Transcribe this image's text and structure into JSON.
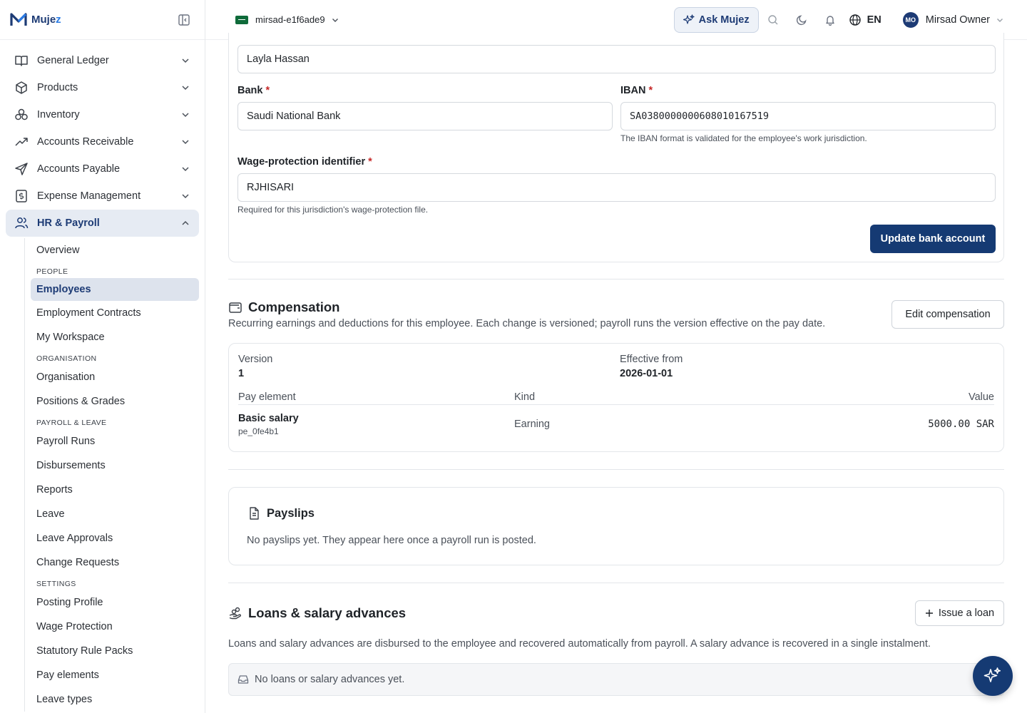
{
  "brand": {
    "name_a": "Muje",
    "name_b": "z"
  },
  "sidebar": {
    "items": [
      {
        "label": "General Ledger",
        "icon": "book-icon"
      },
      {
        "label": "Products",
        "icon": "box-icon"
      },
      {
        "label": "Inventory",
        "icon": "boxes-icon"
      },
      {
        "label": "Accounts Receivable",
        "icon": "trend-up-icon"
      },
      {
        "label": "Accounts Payable",
        "icon": "send-icon"
      },
      {
        "label": "Expense Management",
        "icon": "receipt-icon"
      },
      {
        "label": "HR & Payroll",
        "icon": "users-icon"
      }
    ],
    "hr": {
      "overview": "Overview",
      "section_people": "PEOPLE",
      "employees": "Employees",
      "employment_contracts": "Employment Contracts",
      "my_workspace": "My Workspace",
      "section_organisation": "ORGANISATION",
      "organisation": "Organisation",
      "positions_grades": "Positions & Grades",
      "section_payroll_leave": "PAYROLL & LEAVE",
      "payroll_runs": "Payroll Runs",
      "disbursements": "Disbursements",
      "reports": "Reports",
      "leave": "Leave",
      "leave_approvals": "Leave Approvals",
      "change_requests": "Change Requests",
      "section_settings": "SETTINGS",
      "posting_profile": "Posting Profile",
      "wage_protection": "Wage Protection",
      "statutory_rule_packs": "Statutory Rule Packs",
      "pay_elements": "Pay elements",
      "leave_types": "Leave types"
    }
  },
  "topbar": {
    "org": "mirsad-e1f6ade9",
    "ask": "Ask Mujez",
    "lang": "EN",
    "user_initials": "MO",
    "user_name": "Mirsad Owner"
  },
  "bank": {
    "holder_value": "Layla Hassan",
    "bank_label": "Bank",
    "bank_value": "Saudi National Bank",
    "iban_label": "IBAN",
    "iban_value": "SA0380000000608010167519",
    "iban_hint": "The IBAN format is validated for the employee's work jurisdiction.",
    "wps_label": "Wage-protection identifier",
    "wps_value": "RJHISARI",
    "wps_hint": "Required for this jurisdiction's wage-protection file.",
    "required_mark": "*",
    "update_button": "Update bank account"
  },
  "compensation": {
    "title": "Compensation",
    "description": "Recurring earnings and deductions for this employee. Each change is versioned; payroll runs the version effective on the pay date.",
    "edit_button": "Edit compensation",
    "version_label": "Version",
    "version_value": "1",
    "effective_label": "Effective from",
    "effective_value": "2026-01-01",
    "columns": [
      "Pay element",
      "Kind",
      "Value"
    ],
    "rows": [
      {
        "name": "Basic salary",
        "code": "pe_0fe4b1",
        "kind": "Earning",
        "value": "5000.00",
        "currency": "SAR"
      }
    ]
  },
  "payslips": {
    "title": "Payslips",
    "empty": "No payslips yet. They appear here once a payroll run is posted."
  },
  "loans": {
    "title": "Loans & salary advances",
    "issue_button": "Issue a loan",
    "description": "Loans and salary advances are disbursed to the employee and recovered automatically from payroll. A salary advance is recovered in a single instalment.",
    "empty": "No loans or salary advances yet."
  }
}
